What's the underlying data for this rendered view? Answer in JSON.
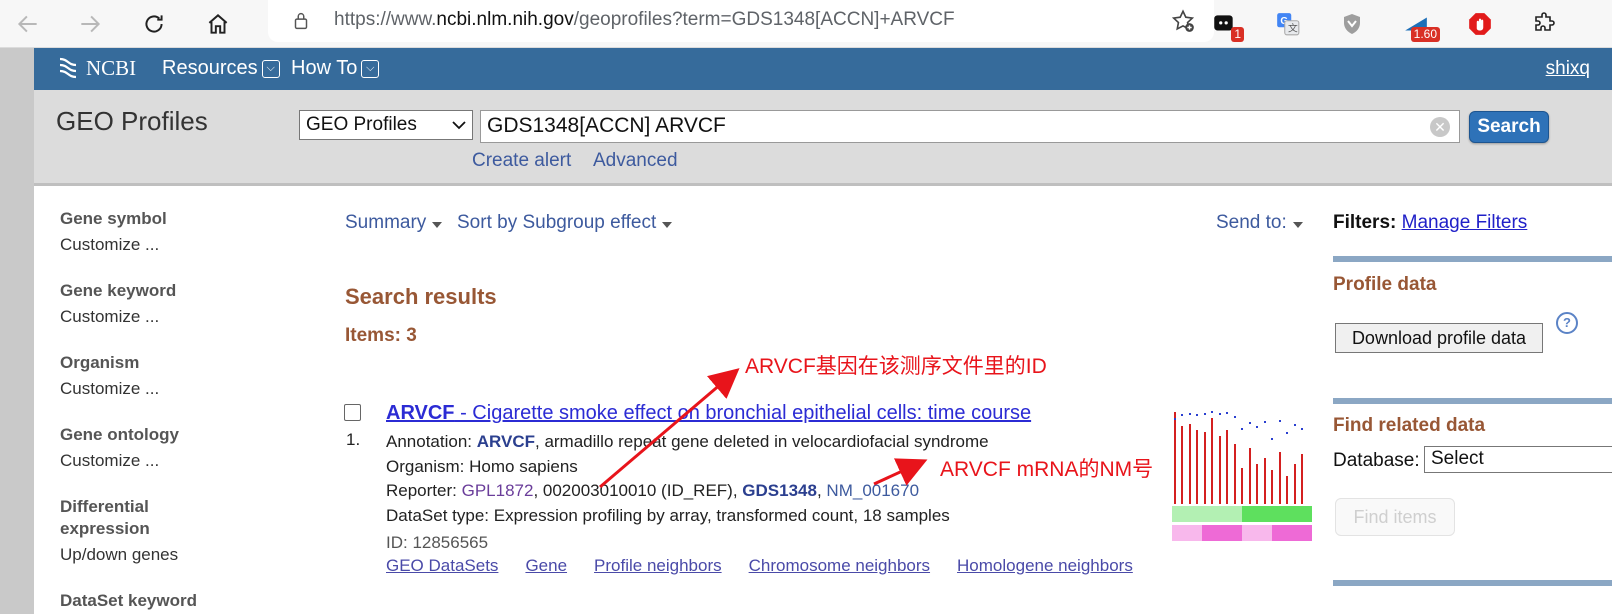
{
  "browser": {
    "url_prefix": "https://www.",
    "url_domain": "ncbi.nlm.nih.gov",
    "url_path": "/geoprofiles?term=GDS1348[ACCN]+ARVCF",
    "ext_badge_1": "1",
    "ext_badge_2": "1.60"
  },
  "header": {
    "logo": "NCBI",
    "menu_resources": "Resources",
    "menu_howto": "How To",
    "user": "shixq"
  },
  "search": {
    "db_title": "GEO Profiles",
    "db_select": "GEO Profiles",
    "query": "GDS1348[ACCN] ARVCF",
    "button": "Search",
    "create_alert": "Create alert",
    "advanced": "Advanced"
  },
  "facets": [
    {
      "title": "Gene symbol",
      "link": "Customize ..."
    },
    {
      "title": "Gene keyword",
      "link": "Customize ..."
    },
    {
      "title": "Organism",
      "link": "Customize ..."
    },
    {
      "title": "Gene ontology",
      "link": "Customize ..."
    },
    {
      "title": "Differential expression",
      "link": "Up/down genes"
    },
    {
      "title": "DataSet keyword",
      "link": ""
    }
  ],
  "toolbar": {
    "summary": "Summary",
    "sort": "Sort by Subgroup effect",
    "send_to": "Send to:"
  },
  "results": {
    "title": "Search results",
    "items": "Items: 3",
    "item": {
      "number": "1.",
      "title_gene": "ARVCF",
      "title_rest": " - Cigarette smoke effect on bronchial epithelial cells: time course",
      "annotation_label": "Annotation: ",
      "annotation_gene": "ARVCF",
      "annotation_rest": ", armadillo repeat gene deleted in velocardiofacial syndrome",
      "organism": "Organism: Homo sapiens",
      "reporter_label": "Reporter: ",
      "reporter_gpl": "GPL1872",
      "reporter_id": ", 002003010010 (ID_REF), ",
      "reporter_gds": "GDS1348",
      "reporter_sep": ", ",
      "reporter_nm": "NM_001670",
      "dataset_type": "DataSet type: Expression profiling by array, transformed count, 18 samples",
      "id": "ID: 12856565",
      "links": [
        "GEO DataSets",
        "Gene",
        "Profile neighbors",
        "Chromosome neighbors",
        "Homologene neighbors"
      ]
    }
  },
  "annotations": {
    "arrow1": "ARVCF基因在该测序文件里的ID",
    "arrow2": "ARVCF mRNA的NM号",
    "color": "#e8141b"
  },
  "sidebar": {
    "filters_label": "Filters:",
    "manage_filters": "Manage Filters",
    "profile_data": "Profile data",
    "download_button": "Download profile data",
    "find_related": "Find related data",
    "database_label": "Database:",
    "database_select": "Select",
    "find_items": "Find items"
  },
  "colors": {
    "header_bg": "#366b9b",
    "section_title": "#985735",
    "link": "#3d5a9e"
  }
}
